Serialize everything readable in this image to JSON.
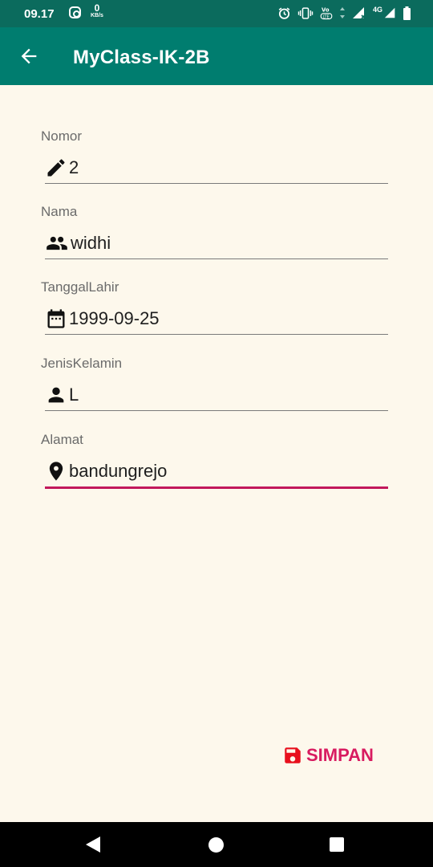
{
  "status_bar": {
    "time": "09.17",
    "net_speed": "0",
    "net_unit": "KB/s",
    "network": "4G"
  },
  "app_bar": {
    "title": "MyClass-IK-2B",
    "back_icon": "arrow-back-icon",
    "color": "#007d6f"
  },
  "form": {
    "fields": [
      {
        "label": "Nomor",
        "value": "2",
        "icon": "pencil-icon"
      },
      {
        "label": "Nama",
        "value": "widhi",
        "icon": "people-icon"
      },
      {
        "label": "TanggalLahir",
        "value": "1999-09-25",
        "icon": "calendar-icon"
      },
      {
        "label": "JenisKelamin",
        "value": "L",
        "icon": "person-icon"
      },
      {
        "label": "Alamat",
        "value": "bandungrejo",
        "icon": "location-pin-icon",
        "focused": true
      }
    ],
    "focus_color": "#c2185b"
  },
  "save_button": {
    "label": "SIMPAN",
    "icon": "save-icon",
    "color": "#d81b60"
  },
  "nav_bar": {
    "items": [
      "back",
      "home",
      "recents"
    ]
  }
}
